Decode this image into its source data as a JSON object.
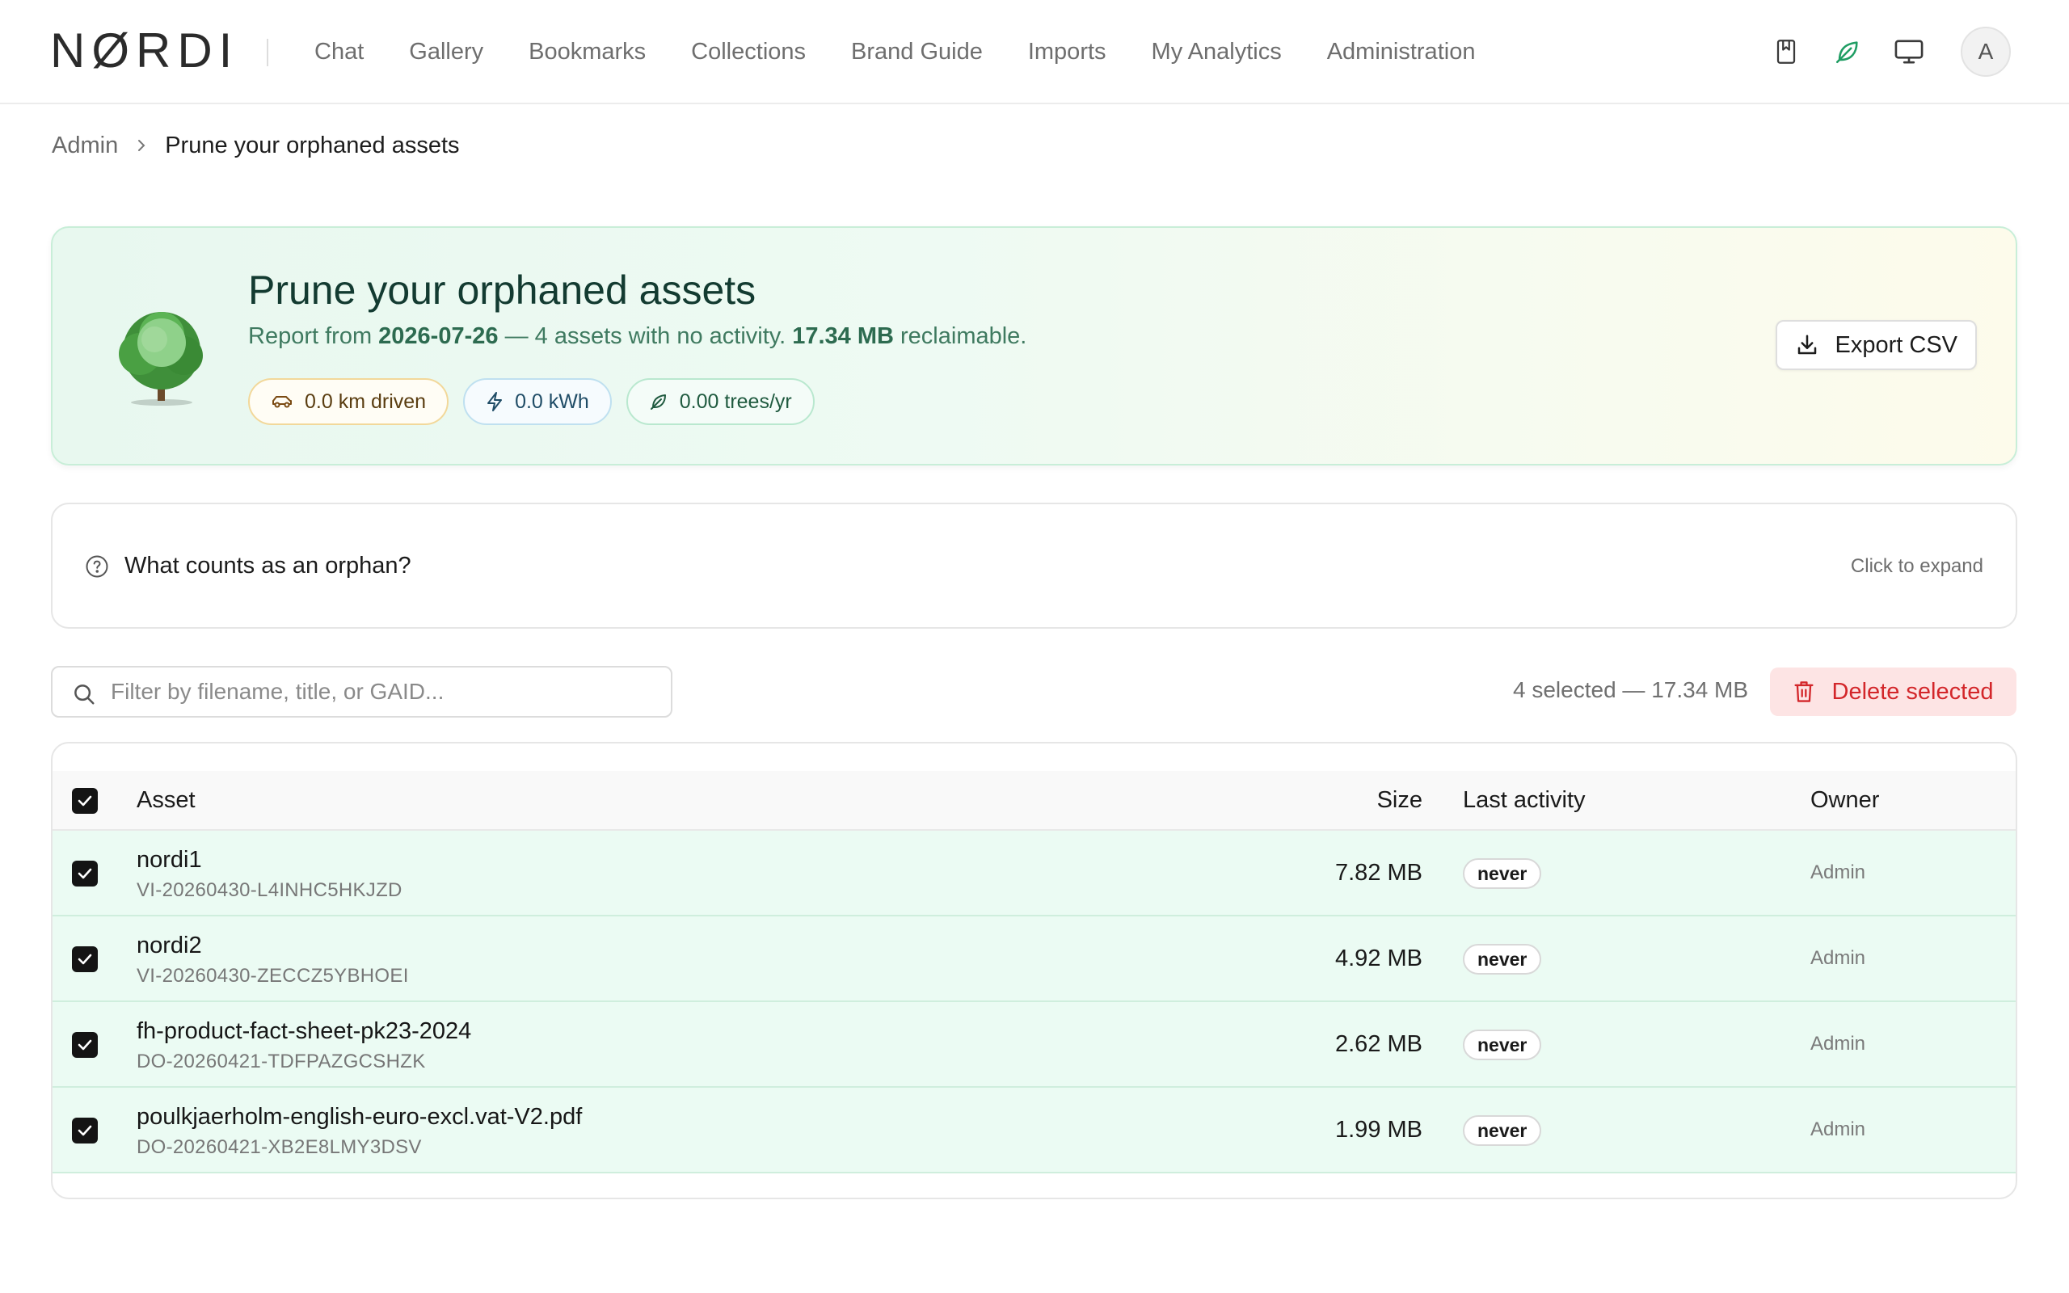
{
  "header": {
    "logo": "NØRDI",
    "nav": [
      "Chat",
      "Gallery",
      "Bookmarks",
      "Collections",
      "Brand Guide",
      "Imports",
      "My Analytics",
      "Administration"
    ],
    "icons": [
      "bookmark-icon",
      "leaf-icon",
      "monitor-icon"
    ],
    "avatar_initial": "A",
    "leaf_color": "#1f9d63"
  },
  "breadcrumb": {
    "parent": "Admin",
    "current": "Prune your orphaned assets"
  },
  "hero": {
    "title": "Prune your orphaned assets",
    "sub_prefix": "Report from ",
    "report_date": "2026-07-26",
    "sub_middle": " — 4 assets with no activity. ",
    "reclaimable": "17.34 MB",
    "sub_suffix": " reclaimable.",
    "chips": {
      "km": "0.0 km driven",
      "kwh": "0.0 kWh",
      "trees": "0.00 trees/yr"
    },
    "export_label": "Export CSV"
  },
  "faq": {
    "title": "What counts as an orphan?",
    "hint": "Click to expand"
  },
  "toolbar": {
    "search_placeholder": "Filter by filename, title, or GAID...",
    "selection_info": "4 selected — 17.34 MB",
    "delete_label": "Delete selected"
  },
  "table": {
    "columns": {
      "asset": "Asset",
      "size": "Size",
      "last_activity": "Last activity",
      "owner": "Owner"
    },
    "all_selected": true,
    "rows": [
      {
        "name": "nordi1",
        "id": "VI-20260430-L4INHC5HKJZD",
        "size": "7.82 MB",
        "last_activity": "never",
        "owner": "Admin",
        "selected": true
      },
      {
        "name": "nordi2",
        "id": "VI-20260430-ZECCZ5YBHOEI",
        "size": "4.92 MB",
        "last_activity": "never",
        "owner": "Admin",
        "selected": true
      },
      {
        "name": "fh-product-fact-sheet-pk23-2024",
        "id": "DO-20260421-TDFPAZGCSHZK",
        "size": "2.62 MB",
        "last_activity": "never",
        "owner": "Admin",
        "selected": true
      },
      {
        "name": "poulkjaerholm-english-euro-excl.vat-V2.pdf",
        "id": "DO-20260421-XB2E8LMY3DSV",
        "size": "1.99 MB",
        "last_activity": "never",
        "owner": "Admin",
        "selected": true
      }
    ]
  },
  "colors": {
    "hero_title": "#133b31",
    "hero_text": "#3f7a60",
    "delete_red": "#d3262a",
    "row_selected_bg": "#ebfbf3"
  }
}
